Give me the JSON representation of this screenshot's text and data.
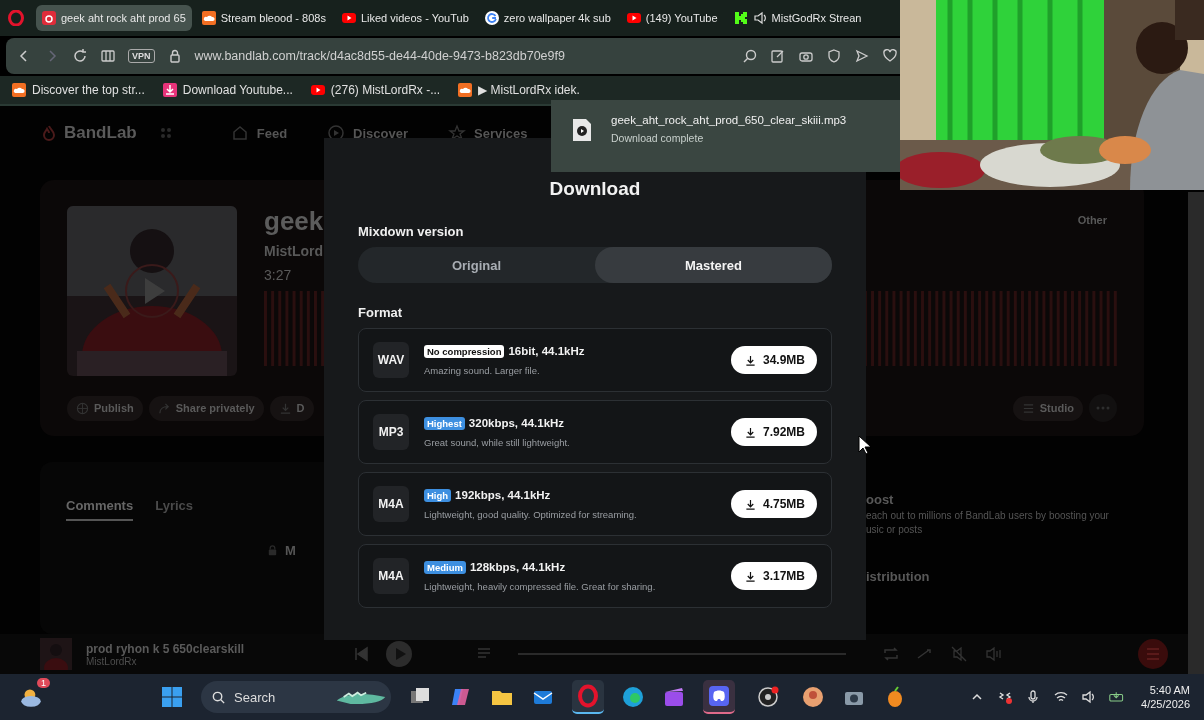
{
  "tabs": [
    {
      "title": "geek aht rock aht prod 65",
      "kind": "bandlab",
      "selected": true,
      "audio": false
    },
    {
      "title": "Stream bleood - 808s",
      "kind": "soundcloud",
      "selected": false,
      "audio": false
    },
    {
      "title": "Liked videos - YouTub",
      "kind": "youtube",
      "selected": false,
      "audio": false
    },
    {
      "title": "zero wallpaper 4k sub",
      "kind": "google",
      "selected": false,
      "audio": false
    },
    {
      "title": "(149) YouTube",
      "kind": "youtube",
      "selected": false,
      "audio": false
    },
    {
      "title": "MistGodRx Strean",
      "kind": "kick",
      "selected": false,
      "audio": true
    }
  ],
  "address_bar": {
    "vpn": "VPN",
    "url": "www.bandlab.com/track/d4ac8d55-de44-40de-9473-b823db70e9f9"
  },
  "bookmarks": [
    {
      "label": "Discover the top str...",
      "kind": "soundcloud"
    },
    {
      "label": "Download Youtube...",
      "kind": "download"
    },
    {
      "label": "(276) MistLordRx -...",
      "kind": "youtube"
    },
    {
      "label": "▶ MistLordRx idek.",
      "kind": "soundcloud"
    }
  ],
  "page": {
    "logo": "BandLab",
    "nav": [
      "Feed",
      "Discover",
      "Services"
    ],
    "track": {
      "title": "geek",
      "artist": "MistLord",
      "duration": "3:27",
      "tag": "Other",
      "actions": [
        "Publish",
        "Share privately",
        "D"
      ],
      "studio": "Studio"
    },
    "comments": {
      "tabs": [
        {
          "label": "Comments",
          "selected": true
        },
        {
          "label": "Lyrics",
          "selected": false
        }
      ],
      "hint": "M"
    },
    "promo": {
      "title": "oost",
      "text": "each out to millions of BandLab users by boosting your",
      "text2": "usic or posts",
      "next_title": "istribution"
    },
    "player": {
      "title": "prod ryhon k 5 650clearskill",
      "artist": "MistLordRx"
    }
  },
  "download_dialog": {
    "title": "Download",
    "mixdown_label": "Mixdown version",
    "versions": [
      {
        "label": "Original",
        "selected": false
      },
      {
        "label": "Mastered",
        "selected": true
      }
    ],
    "format_label": "Format",
    "formats": [
      {
        "format": "WAV",
        "badge": "No compression",
        "color": "#ffffff",
        "spec": "16bit, 44.1kHz",
        "description": "Amazing sound. Larger file.",
        "size": "34.9MB"
      },
      {
        "format": "MP3",
        "badge": "Highest",
        "color": "#3d8fe0",
        "spec": "320kbps, 44.1kHz",
        "description": "Great sound, while still lightweight.",
        "size": "7.92MB"
      },
      {
        "format": "M4A",
        "badge": "High",
        "color": "#3d8fe0",
        "spec": "192kbps, 44.1kHz",
        "description": "Lightweight, good quality. Optimized for streaming.",
        "size": "4.75MB"
      },
      {
        "format": "M4A",
        "badge": "Medium",
        "color": "#3d8fe0",
        "spec": "128kbps, 44.1kHz",
        "description": "Lightweight, heavily compressed file. Great for sharing.",
        "size": "3.17MB"
      }
    ]
  },
  "notification": {
    "filename": "geek_aht_rock_aht_prod_650_clear_skiii.mp3",
    "status": "Download complete"
  },
  "taskbar": {
    "weather_badge": "1",
    "search": "Search",
    "time": "5:40 AM",
    "date": "4/25/2026"
  }
}
